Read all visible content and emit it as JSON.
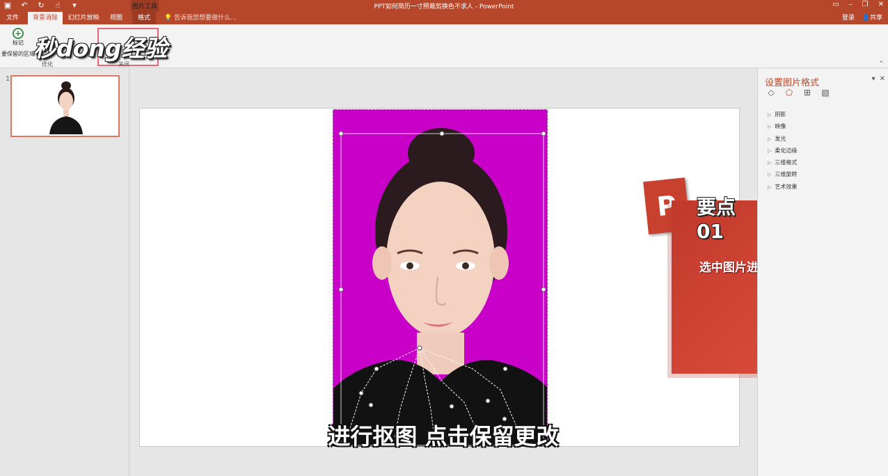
{
  "window": {
    "title": "PPT如何简历一寸照裁剪换色不求人 - PowerPoint",
    "context_tools_label": "图片工具"
  },
  "quick_access": [
    "save-icon",
    "undo-icon",
    "redo-icon",
    "touch-mode-icon",
    "customize-icon"
  ],
  "tabs": [
    {
      "label": "文件"
    },
    {
      "label": "背景消除"
    },
    {
      "label": "幻灯片放映"
    },
    {
      "label": "视图"
    },
    {
      "label": "格式"
    }
  ],
  "tell_me": "告诉我您想要做什么...",
  "account": {
    "login": "登录",
    "share": "共享"
  },
  "ribbon": {
    "mark_label": "标记",
    "mark_desc": "要保留的区域",
    "group_optimize": "优化",
    "group_close": "关闭"
  },
  "logo_text": "秒dong经验",
  "thumbnails": [
    {
      "number": "1"
    }
  ],
  "slide": {
    "caption": "进行抠图 点击保留更改",
    "tip_title": "要点01",
    "tip_text": "选中图片进入格式命令",
    "tip_icon_letter": "P"
  },
  "format_pane": {
    "title": "设置图片格式",
    "icons": [
      "fill-line-icon",
      "effects-icon",
      "size-properties-icon",
      "picture-icon"
    ],
    "items": [
      "阴影",
      "映像",
      "发光",
      "柔化边缘",
      "三维格式",
      "三维旋转",
      "艺术效果"
    ]
  },
  "colors": {
    "brand": "#b7472a",
    "photo_background": "#c800c8",
    "highlight": "#e8647a"
  }
}
